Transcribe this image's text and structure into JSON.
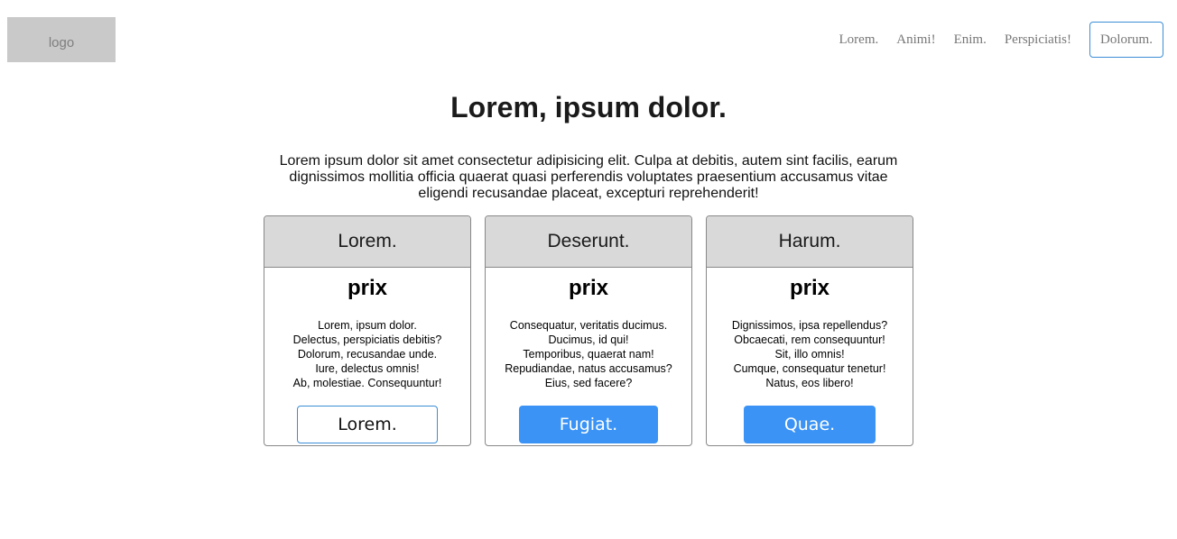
{
  "logo": {
    "text": "logo"
  },
  "nav": {
    "links": [
      "Lorem.",
      "Animi!",
      "Enim.",
      "Perspiciatis!"
    ],
    "button": "Dolorum."
  },
  "hero": {
    "title": "Lorem, ipsum dolor.",
    "intro": "Lorem ipsum dolor sit amet consectetur adipisicing elit. Culpa at debitis, autem sint facilis, earum dignissimos mollitia officia quaerat quasi perferendis voluptates praesentium accusamus vitae eligendi recusandae placeat, excepturi reprehenderit!"
  },
  "colors": {
    "accent": "#3a93f5",
    "outline": "#3b8ed6",
    "header_bg": "#d9d9d9",
    "logo_bg": "#c9c9c9"
  },
  "cards": [
    {
      "header": "Lorem.",
      "price": "prix",
      "features": [
        "Lorem, ipsum dolor.",
        "Delectus, perspiciatis debitis?",
        "Dolorum, recusandae unde.",
        "Iure, delectus omnis!",
        "Ab, molestiae. Consequuntur!"
      ],
      "button": "Lorem.",
      "button_style": "outline"
    },
    {
      "header": "Deserunt.",
      "price": "prix",
      "features": [
        "Consequatur, veritatis ducimus.",
        "Ducimus, id qui!",
        "Temporibus, quaerat nam!",
        "Repudiandae, natus accusamus?",
        "Eius, sed facere?"
      ],
      "button": "Fugiat.",
      "button_style": "filled"
    },
    {
      "header": "Harum.",
      "price": "prix",
      "features": [
        "Dignissimos, ipsa repellendus?",
        "Obcaecati, rem consequuntur!",
        "Sit, illo omnis!",
        "Cumque, consequatur tenetur!",
        "Natus, eos libero!"
      ],
      "button": "Quae.",
      "button_style": "filled"
    }
  ]
}
